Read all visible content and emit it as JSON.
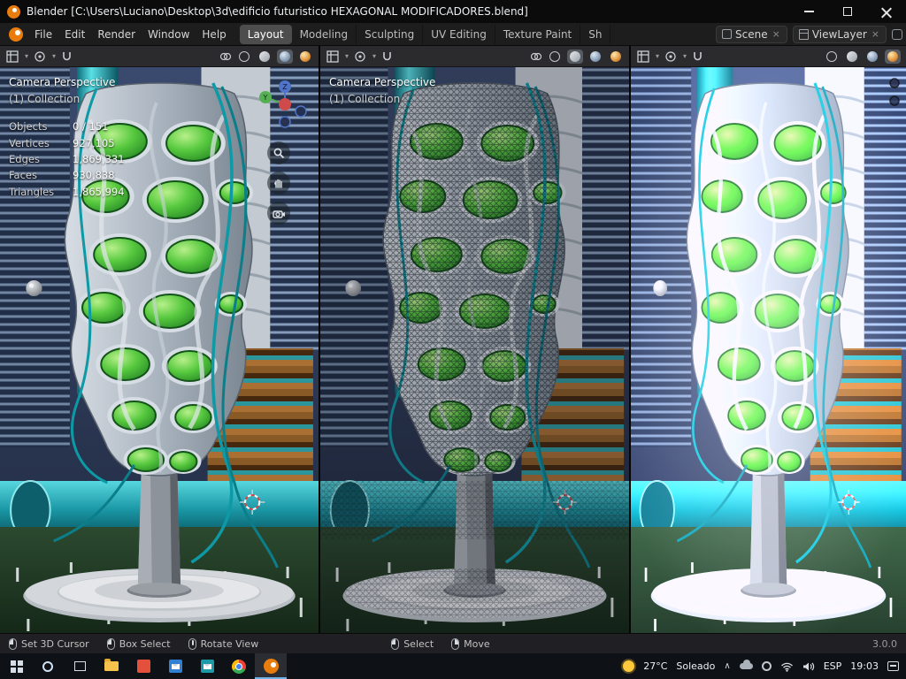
{
  "window": {
    "title": "Blender [C:\\Users\\Luciano\\Desktop\\3d\\edificio futuristico HEXAGONAL MODIFICADORES.blend]"
  },
  "menubar": {
    "menus": [
      "File",
      "Edit",
      "Render",
      "Window",
      "Help"
    ],
    "workspaces": [
      "Layout",
      "Modeling",
      "Sculpting",
      "UV Editing",
      "Texture Paint",
      "Sh"
    ],
    "scene_label": "Scene",
    "viewlayer_label": "ViewLayer",
    "close_x": "×"
  },
  "viewports": {
    "left": {
      "view_label": "Camera Perspective",
      "collection_label": "(1) Collection",
      "stats": [
        {
          "label": "Objects",
          "value": "0 / 151"
        },
        {
          "label": "Vertices",
          "value": "927,105"
        },
        {
          "label": "Edges",
          "value": "1,869,331"
        },
        {
          "label": "Faces",
          "value": "930,838"
        },
        {
          "label": "Triangles",
          "value": "1,865,994"
        }
      ]
    },
    "middle": {
      "view_label": "Camera Perspective",
      "collection_label": "(1) Collection"
    }
  },
  "statusbar": {
    "hints": [
      {
        "label": "Set 3D Cursor"
      },
      {
        "label": "Box Select"
      },
      {
        "label": "Rotate View"
      },
      {
        "label": "Select"
      },
      {
        "label": "Move"
      }
    ],
    "version": "3.0.0"
  },
  "taskbar": {
    "weather_temp": "27°C",
    "weather_desc": "Soleado",
    "language": "ESP",
    "time": "19:03",
    "tray_chevron": "∧"
  },
  "colors": {
    "blender_orange": "#e87d0d",
    "accent_teal": "#19a7b4",
    "window_green": "#4fbf3e"
  }
}
